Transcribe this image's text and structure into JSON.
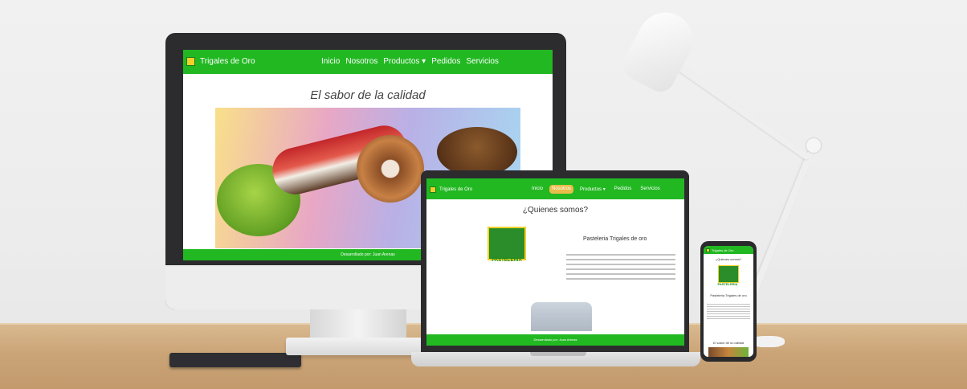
{
  "desktop": {
    "brand": "Trigales de Oro",
    "nav": [
      "Inicio",
      "Nosotros",
      "Productos ▾",
      "Pedidos",
      "Servicios"
    ],
    "headline": "El sabor de la calidad",
    "footer": "Desarrollado por: Juan Arenas"
  },
  "laptop": {
    "brand": "Trigales de Oro",
    "nav": [
      "Inicio",
      "Nosotros",
      "Productos ▾",
      "Pedidos",
      "Servicios"
    ],
    "active_nav": "Nosotros",
    "title": "¿Quienes somos?",
    "logo_word": "PASTELERIA",
    "subtitle": "Pasteleria Trigales de oro",
    "footer": "Desarrollado por: Juan Arenas"
  },
  "phone": {
    "brand": "Trigales de Oro",
    "title": "¿Quienes somos?",
    "logo_word": "PASTELERIA",
    "subtitle": "Pasteleria Trigales de oro",
    "headline": "El sabor de la calidad"
  },
  "colors": {
    "brand_green": "#22b822",
    "accent_gold": "#e8bd4a",
    "device_frame": "#2c2c2e"
  }
}
